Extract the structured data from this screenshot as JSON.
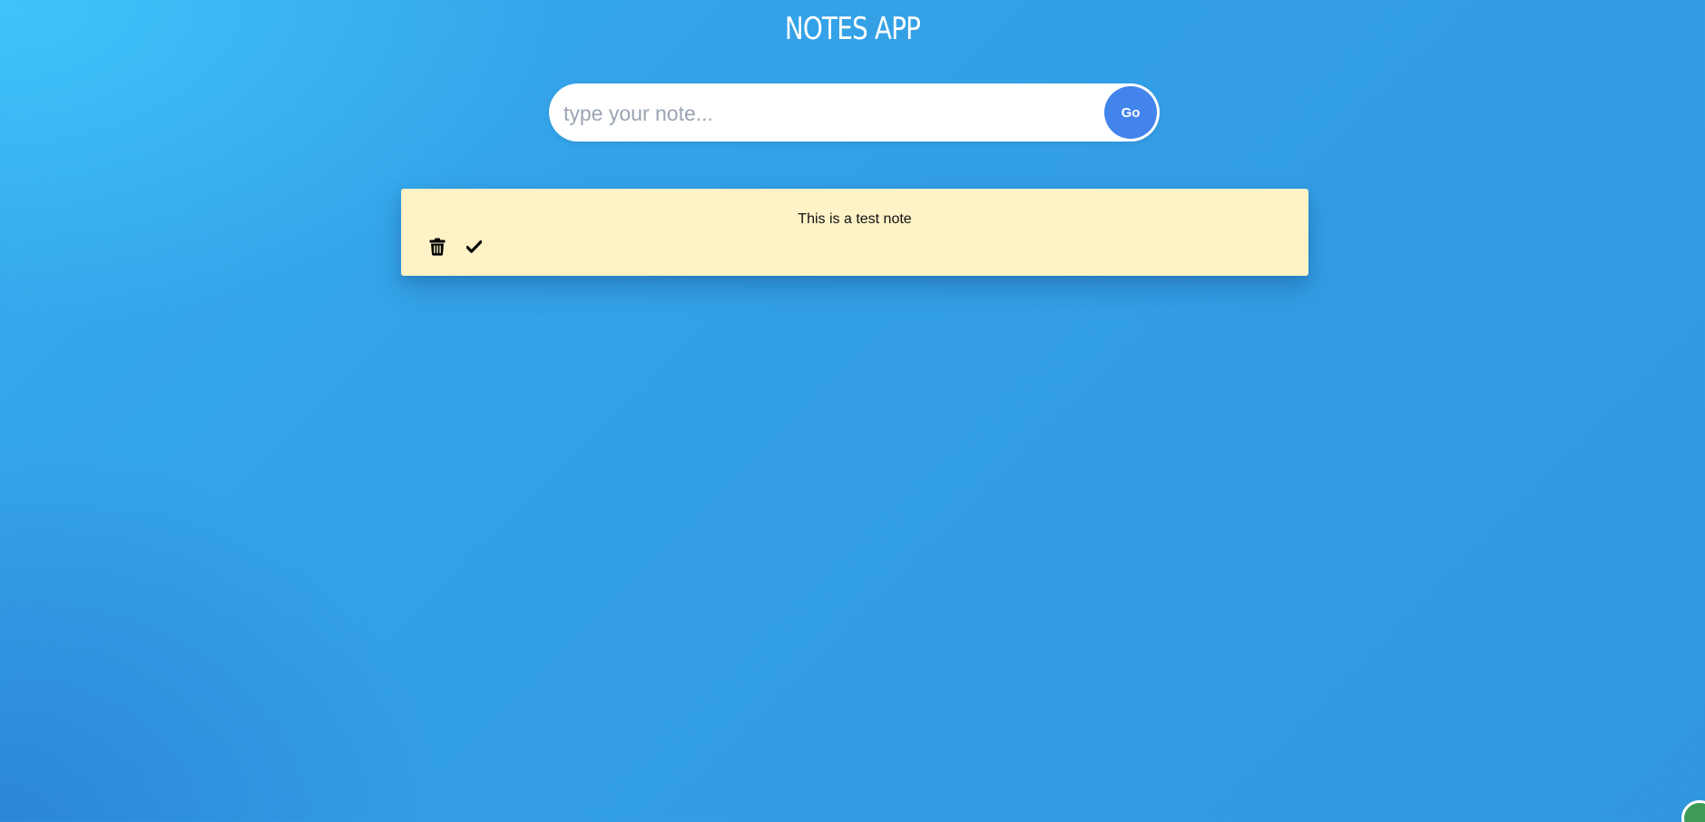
{
  "app": {
    "title": "NOTES APP"
  },
  "composer": {
    "placeholder": "type your note...",
    "value": "",
    "submit_label": "Go"
  },
  "notes": [
    {
      "text": "This is a test note",
      "actions": [
        {
          "icon": "trash-icon",
          "label": "delete"
        },
        {
          "icon": "check-icon",
          "label": "complete"
        }
      ]
    }
  ],
  "colors": {
    "background_top_left": "#40c8fc",
    "background_main": "#339fe6",
    "note_background": "#fef2c6",
    "go_button": "#4384ec",
    "title_text": "#ffffff"
  }
}
